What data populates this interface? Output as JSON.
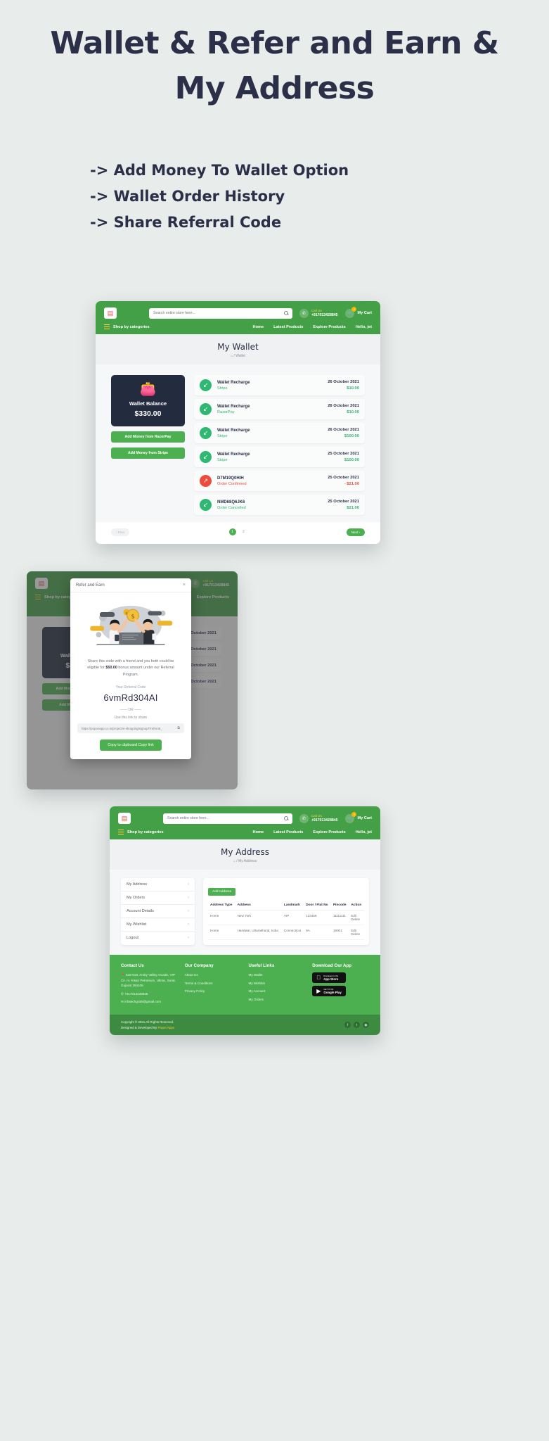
{
  "hero": {
    "title_line1": "Wallet & Refer and Earn &",
    "title_line2": "My Address",
    "bullets": [
      "-> Add Money To Wallet Option",
      "-> Wallet Order History",
      "-> Share Referral Code"
    ]
  },
  "colors": {
    "background": "#e8ecea",
    "brand_green": "#4caf50",
    "header_green": "#43a047",
    "dark_navy": "#232c3f",
    "credit_green": "#2eb872",
    "debit_red": "#ef4b39",
    "accent_yellow": "#f4d44a"
  },
  "header": {
    "logo_icon": "store-logo-icon",
    "search_placeholder": "Search entire store here...",
    "search_value": "",
    "search_icon": "search-icon",
    "call_icon": "phone-icon",
    "call_label": "Call Us",
    "call_number": "+917013428845",
    "cart_icon": "cart-icon",
    "cart_count": "0",
    "cart_label": "My Cart",
    "shop_by_categories": "Shop by categories",
    "nav": [
      {
        "label": "Home"
      },
      {
        "label": "Latest Products"
      },
      {
        "label": "Explore Products"
      },
      {
        "label": "Hello, jet"
      }
    ]
  },
  "wallet_page": {
    "title": "My Wallet",
    "breadcrumb_home_icon": "home-icon",
    "breadcrumb_sep": "/",
    "breadcrumb_current": "Wallet",
    "balance_card": {
      "wallet_icon": "wallet-icon",
      "label": "Wallet Balance",
      "amount": "$330.00"
    },
    "buttons": [
      {
        "label": "Add Money from RazorPay"
      },
      {
        "label": "Add Money from Stripe"
      }
    ],
    "transactions": [
      {
        "icon": "arrow-down-left-icon",
        "direction": "in",
        "title": "Wallet Recharge",
        "status": "Stripe",
        "status_kind": "green",
        "date": "26 October 2021",
        "amount": "$10.00",
        "amount_kind": "green"
      },
      {
        "icon": "arrow-down-left-icon",
        "direction": "in",
        "title": "Wallet Recharge",
        "status": "RazorPay",
        "status_kind": "green",
        "date": "26 October 2021",
        "amount": "$10.00",
        "amount_kind": "green"
      },
      {
        "icon": "arrow-down-left-icon",
        "direction": "in",
        "title": "Wallet Recharge",
        "status": "Stripe",
        "status_kind": "green",
        "date": "26 October 2021",
        "amount": "$100.00",
        "amount_kind": "green"
      },
      {
        "icon": "arrow-down-left-icon",
        "direction": "in",
        "title": "Wallet Recharge",
        "status": "Stripe",
        "status_kind": "green",
        "date": "25 October 2021",
        "amount": "$100.00",
        "amount_kind": "green"
      },
      {
        "icon": "arrow-up-right-icon",
        "direction": "out",
        "title": "D7M19Q0HIH",
        "status": "Order Confirmed",
        "status_kind": "red",
        "date": "25 October 2021",
        "amount": "- $21.00",
        "amount_kind": "red"
      },
      {
        "icon": "arrow-down-left-icon",
        "direction": "in",
        "title": "NMD68Q6JK6",
        "status": "Order Cancelled",
        "status_kind": "green",
        "date": "25 October 2021",
        "amount": "$21.00",
        "amount_kind": "green"
      }
    ],
    "pagination": {
      "prev_label": "‹ Prev",
      "next_label": "Next ›",
      "pages": [
        "1",
        "2"
      ],
      "active_page": "1"
    }
  },
  "refer_modal": {
    "title": "Refer and Earn",
    "close_icon": "close-icon",
    "illustration": "refer-and-earn-illustration",
    "share_text_part1": "Share this code with a friend and you both could be eligible for ",
    "share_amount": "$50.00",
    "share_text_part2": " bonus amount under our Referral Program.",
    "code_label": "Your Referral Code",
    "referral_code": "6vmRd304AI",
    "or_divider": "—— OR ——",
    "use_link_label": "Use this link to share",
    "share_link": "https://poponapp.co.in/project/e-shopping/signup/?referral_",
    "copy_link_icon": "copy-icon",
    "copy_button_label": "Copy to clipboard Copy link"
  },
  "address_page": {
    "title": "My Address",
    "breadcrumb_home_icon": "home-icon",
    "breadcrumb_sep": "/",
    "breadcrumb_current": "My Address",
    "side_menu": [
      {
        "label": "My Address",
        "icon": "chevron-right-icon"
      },
      {
        "label": "My Orders",
        "icon": "chevron-right-icon"
      },
      {
        "label": "Account Details",
        "icon": "chevron-right-icon"
      },
      {
        "label": "My Wishlist",
        "icon": "chevron-right-icon"
      },
      {
        "label": "Logout",
        "icon": "chevron-right-icon"
      }
    ],
    "add_button": "Add Address",
    "table_headers": [
      "Address Type",
      "Address",
      "Landmark",
      "Door / Flat No",
      "Pincode",
      "Action"
    ],
    "rows": [
      {
        "type": "Home",
        "address": "New York",
        "landmark": "VIP",
        "door": "123456",
        "pincode": "11111111",
        "actions": [
          "Edit",
          "Delete"
        ]
      },
      {
        "type": "Home",
        "address": "Haridwar, Uttarakhand, India",
        "landmark": "Connecticut",
        "door": "9A",
        "pincode": "19001",
        "actions": [
          "Edit",
          "Delete"
        ]
      }
    ]
  },
  "footer": {
    "contact": {
      "heading": "Contact Us",
      "location_icon": "location-pin-icon",
      "address": "518-519, Amby Valley Arcade, VIP Cir. nr. Kisan Petroleum, Ultran, Surat, Gujarat 394108",
      "phone_icon": "phone-icon",
      "phone": "+917013428845",
      "email_icon": "envelope-icon",
      "email": "infotechgrahi@gmail.com"
    },
    "company": {
      "heading": "Our Company",
      "links": [
        "About Us",
        "Terms & Conditions",
        "Privacy Policy"
      ]
    },
    "useful": {
      "heading": "Useful Links",
      "links": [
        "My Wallet",
        "My Wishlist",
        "My Account",
        "My Orders"
      ]
    },
    "download": {
      "heading": "Download Our App",
      "badges": [
        {
          "icon": "apple-icon",
          "small": "Download on the",
          "big": "App Store"
        },
        {
          "icon": "play-icon",
          "small": "GET IT ON",
          "big": "Google Play"
        }
      ]
    },
    "bottom": {
      "copyright": "Copyright © 2021,All Rights Reserved.",
      "designed_prefix": "Designed & Developed By ",
      "designed_by": "Payan Apps",
      "socials": [
        {
          "icon": "facebook-icon",
          "glyph": "f"
        },
        {
          "icon": "twitter-icon",
          "glyph": "t"
        },
        {
          "icon": "instagram-icon",
          "glyph": "◉"
        }
      ]
    }
  }
}
